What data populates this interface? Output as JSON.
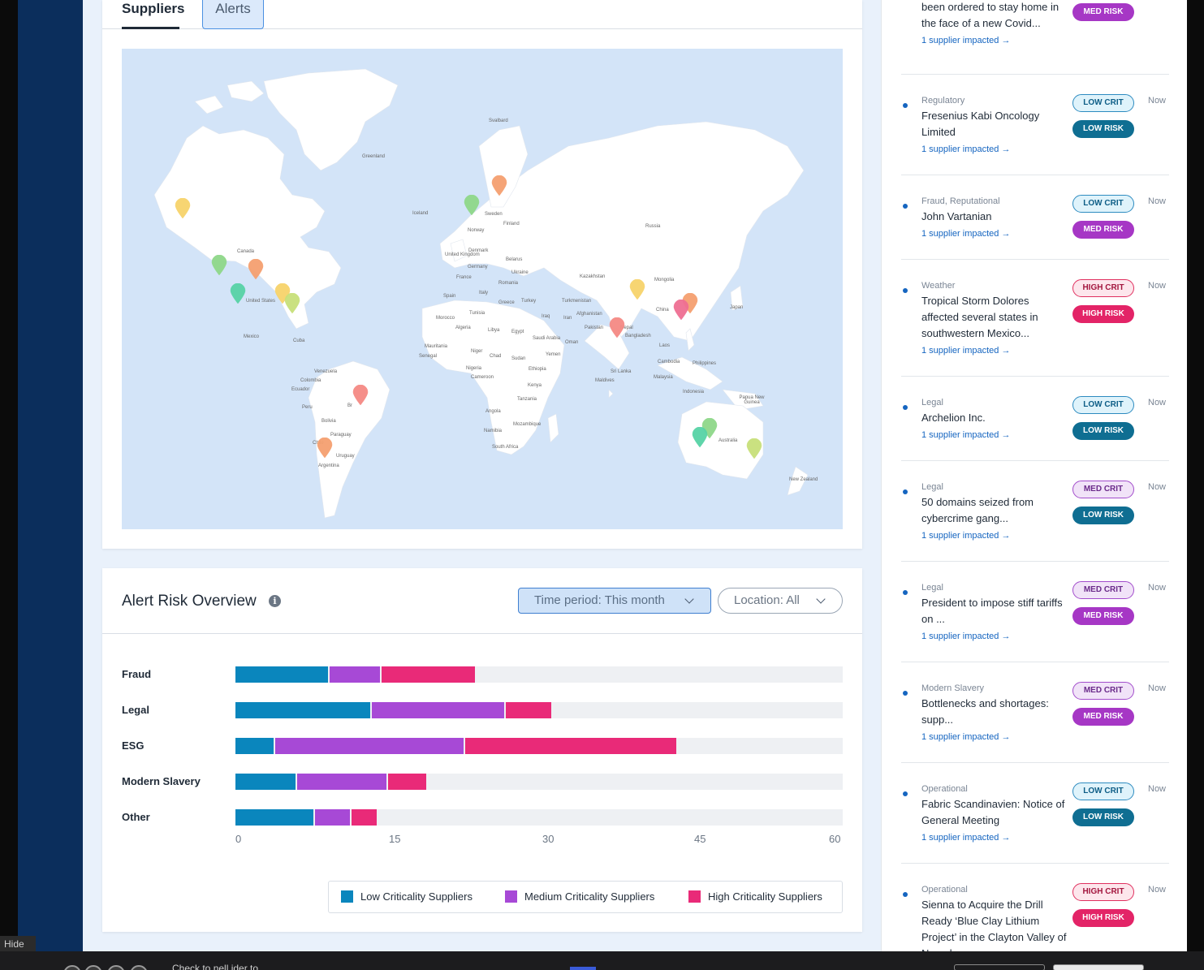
{
  "tabs": {
    "suppliers": "Suppliers",
    "alerts": "Alerts"
  },
  "map": {
    "labels": {
      "greenland": "Greenland",
      "svalbard": "Svalbard",
      "iceland": "Iceland",
      "sweden": "Sweden",
      "finland": "Finland",
      "norway": "Norway",
      "russia": "Russia",
      "canada": "Canada",
      "united_kingdom": "United Kingdom",
      "denmark": "Denmark",
      "belarus": "Belarus",
      "germany": "Germany",
      "ukraine": "Ukraine",
      "france": "France",
      "romania": "Romania",
      "kazakhstan": "Kazakhstan",
      "mongolia": "Mongolia",
      "united_states": "United States",
      "spain": "Spain",
      "italy": "Italy",
      "greece": "Greece",
      "turkey": "Turkey",
      "turkmenistan": "Turkmenistan",
      "tunisia": "Tunisia",
      "morocco": "Morocco",
      "iraq": "Iraq",
      "iran": "Iran",
      "afghanistan": "Afghanistan",
      "china": "China",
      "japan": "Japan",
      "algeria": "Algeria",
      "libya": "Libya",
      "egypt": "Egypt",
      "pakistan": "Pakistan",
      "nepal": "Nepal",
      "saudi_arabia": "Saudi Arabia",
      "oman": "Oman",
      "bangladesh": "Bangladesh",
      "mexico": "Mexico",
      "cuba": "Cuba",
      "mauritania": "Mauritania",
      "niger": "Niger",
      "chad": "Chad",
      "sudan": "Sudan",
      "yemen": "Yemen",
      "laos": "Laos",
      "senegal": "Senegal",
      "nigeria": "Nigeria",
      "ethiopia": "Ethiopia",
      "cambodia": "Cambodia",
      "philippines": "Philippines",
      "venezuela": "Venezuela",
      "colombia": "Colombia",
      "cameroon": "Cameroon",
      "sri_lanka": "Sri Lanka",
      "malaysia": "Malaysia",
      "maldives": "Maldives",
      "ecuador": "Ecuador",
      "kenya": "Kenya",
      "indonesia": "Indonesia",
      "peru": "Peru",
      "brazil": "Br",
      "tanzania": "Tanzania",
      "papua_new_guinea": "Papua New Guinea",
      "bolivia": "Bolivia",
      "angola": "Angola",
      "paraguay": "Paraguay",
      "mozambique": "Mozambique",
      "namibia": "Namibia",
      "australia": "Australia",
      "chile": "Chile",
      "south_africa": "South Africa",
      "uruguay": "Uruguay",
      "argentina": "Argentina",
      "new_zealand": "New Zealand"
    },
    "pin_colors": {
      "yellow": "#f7d36b",
      "green": "#8fd88a",
      "orange": "#f5a070",
      "teal": "#57d3a6",
      "salmon": "#f58a84",
      "pink": "#ef6f93",
      "lime": "#c8e07a"
    }
  },
  "risk_overview": {
    "title": "Alert Risk Overview",
    "info_icon": "info-circle-icon",
    "time_filter": "Time period: This month",
    "location_filter": "Location: All",
    "chart_data": {
      "type": "bar",
      "orientation": "horizontal",
      "stacked": true,
      "categories": [
        "Fraud",
        "Legal",
        "ESG",
        "Modern Slavery",
        "Other"
      ],
      "series": [
        {
          "name": "Low Criticality Suppliers",
          "color": "#0a86bd",
          "values": [
            9.3,
            13.5,
            3.9,
            6.1,
            7.9
          ]
        },
        {
          "name": "Medium Criticality Suppliers",
          "color": "#a749d6",
          "values": [
            5.1,
            13.2,
            18.8,
            9.0,
            3.6
          ]
        },
        {
          "name": "High Criticality Suppliers",
          "color": "#e92a78",
          "values": [
            9.4,
            4.7,
            21.0,
            3.9,
            2.6
          ]
        }
      ],
      "x_ticks": [
        "0",
        "15",
        "30",
        "45",
        "60"
      ],
      "xlim": [
        0,
        60
      ],
      "legend_position": "bottom-right"
    }
  },
  "alerts": {
    "items": [
      {
        "category": "",
        "title": "Residents of Gurgaon have been ordered to stay home in the face of a new Covid...",
        "link": "1 supplier impacted",
        "crit": "",
        "crit_class": "",
        "risk": "MED RISK",
        "risk_class": "b-medrisk",
        "time": ""
      },
      {
        "category": "Regulatory",
        "title": "Fresenius Kabi Oncology Limited",
        "link": "1 supplier impacted",
        "crit": "LOW CRIT",
        "crit_class": "b-lowcrit",
        "risk": "LOW RISK",
        "risk_class": "b-lowrisk",
        "time": "Now"
      },
      {
        "category": "Fraud, Reputational",
        "title": "John Vartanian",
        "link": "1 supplier impacted",
        "crit": "LOW CRIT",
        "crit_class": "b-lowcrit",
        "risk": "MED RISK",
        "risk_class": "b-medrisk",
        "time": "Now"
      },
      {
        "category": "Weather",
        "title": "Tropical Storm Dolores affected several states in southwestern Mexico...",
        "link": "1 supplier impacted",
        "crit": "HIGH CRIT",
        "crit_class": "b-highcrit",
        "risk": "HIGH RISK",
        "risk_class": "b-highrisk",
        "time": "Now"
      },
      {
        "category": "Legal",
        "title": "Archelion Inc.",
        "link": "1 supplier impacted",
        "crit": "LOW CRIT",
        "crit_class": "b-lowcrit",
        "risk": "LOW RISK",
        "risk_class": "b-lowrisk",
        "time": "Now"
      },
      {
        "category": "Legal",
        "title": "50 domains seized from cybercrime gang...",
        "link": "1 supplier impacted",
        "crit": "MED CRIT",
        "crit_class": "b-medcrit",
        "risk": "LOW RISK",
        "risk_class": "b-lowrisk",
        "time": "Now"
      },
      {
        "category": "Legal",
        "title": "President to impose stiff tariffs on ...",
        "link": "1 supplier impacted",
        "crit": "MED CRIT",
        "crit_class": "b-medcrit",
        "risk": "MED RISK",
        "risk_class": "b-medrisk",
        "time": "Now"
      },
      {
        "category": "Modern Slavery",
        "title": "Bottlenecks and shortages: supp...",
        "link": "1 supplier impacted",
        "crit": "MED CRIT",
        "crit_class": "b-medcrit",
        "risk": "MED RISK",
        "risk_class": "b-medrisk",
        "time": "Now"
      },
      {
        "category": "Operational",
        "title": "Fabric Scandinavien: Notice of General Meeting",
        "link": "1 supplier impacted",
        "crit": "LOW CRIT",
        "crit_class": "b-lowcrit",
        "risk": "LOW RISK",
        "risk_class": "b-lowrisk",
        "time": "Now"
      },
      {
        "category": "Operational",
        "title": "Sienna to Acquire the Drill Ready ‘Blue Clay Lithium Project’ in the Clayton Valley of Nevada",
        "link": "1 supplier impacted",
        "crit": "HIGH CRIT",
        "crit_class": "b-highcrit",
        "risk": "HIGH RISK",
        "risk_class": "b-highrisk",
        "time": "Now"
      }
    ],
    "link_arrow": "→"
  },
  "footer": {
    "hide_label": "Hide",
    "bottom_text": "Check to nell ider to"
  }
}
